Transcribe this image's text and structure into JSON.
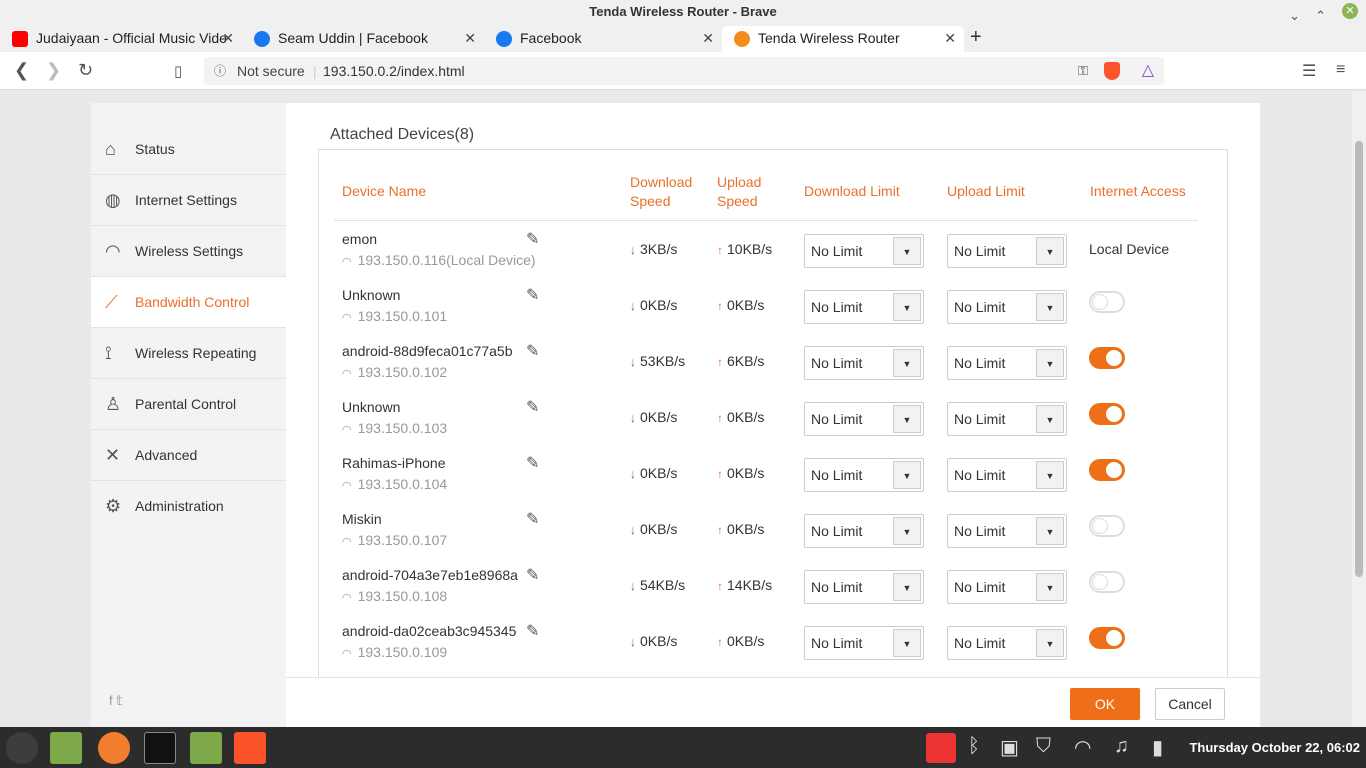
{
  "window": {
    "title": "Tenda Wireless Router - Brave",
    "min": "⌄",
    "max": "⌃",
    "close": "✕"
  },
  "tabs": [
    {
      "label": "Judaiyaan - Official Music Vide",
      "icon_color": "#ff0000"
    },
    {
      "label": "Seam Uddin | Facebook",
      "icon_color": "#1877f2"
    },
    {
      "label": "Facebook",
      "icon_color": "#1877f2"
    },
    {
      "label": "Tenda Wireless Router",
      "icon_color": "#f58b1f"
    }
  ],
  "tab_close": "✕",
  "new_tab": "+",
  "nav": {
    "security": "Not secure",
    "url": "193.150.0.2/index.html"
  },
  "sidebar": {
    "items": [
      {
        "label": "Status",
        "icon": "router-icon"
      },
      {
        "label": "Internet Settings",
        "icon": "globe-icon"
      },
      {
        "label": "Wireless Settings",
        "icon": "wifi-icon"
      },
      {
        "label": "Bandwidth Control",
        "icon": "chart-icon"
      },
      {
        "label": "Wireless Repeating",
        "icon": "antenna-icon"
      },
      {
        "label": "Parental Control",
        "icon": "family-icon"
      },
      {
        "label": "Advanced",
        "icon": "tools-icon"
      },
      {
        "label": "Administration",
        "icon": "gear-icon"
      }
    ],
    "active_index": 3,
    "social": "f  𝕥"
  },
  "panel": {
    "title": "Attached Devices(8)",
    "headers": {
      "device_name": "Device Name",
      "download_speed": "Download Speed",
      "upload_speed": "Upload Speed",
      "download_limit": "Download Limit",
      "upload_limit": "Upload Limit",
      "internet_access": "Internet Access"
    },
    "devices": [
      {
        "name": "emon",
        "ip": "193.150.0.116(Local Device)",
        "down": "3KB/s",
        "up": "10KB/s",
        "dl_limit": "No Limit",
        "ul_limit": "No Limit",
        "access": "Local Device"
      },
      {
        "name": "Unknown",
        "ip": "193.150.0.101",
        "down": "0KB/s",
        "up": "0KB/s",
        "dl_limit": "No Limit",
        "ul_limit": "No Limit",
        "access": false
      },
      {
        "name": "android-88d9feca01c77a5b",
        "ip": "193.150.0.102",
        "down": "53KB/s",
        "up": "6KB/s",
        "dl_limit": "No Limit",
        "ul_limit": "No Limit",
        "access": true
      },
      {
        "name": "Unknown",
        "ip": "193.150.0.103",
        "down": "0KB/s",
        "up": "0KB/s",
        "dl_limit": "No Limit",
        "ul_limit": "No Limit",
        "access": true
      },
      {
        "name": "Rahimas-iPhone",
        "ip": "193.150.0.104",
        "down": "0KB/s",
        "up": "0KB/s",
        "dl_limit": "No Limit",
        "ul_limit": "No Limit",
        "access": true
      },
      {
        "name": "Miskin",
        "ip": "193.150.0.107",
        "down": "0KB/s",
        "up": "0KB/s",
        "dl_limit": "No Limit",
        "ul_limit": "No Limit",
        "access": false
      },
      {
        "name": "android-704a3e7eb1e8968a",
        "ip": "193.150.0.108",
        "down": "54KB/s",
        "up": "14KB/s",
        "dl_limit": "No Limit",
        "ul_limit": "No Limit",
        "access": false
      },
      {
        "name": "android-da02ceab3c945345",
        "ip": "193.150.0.109",
        "down": "0KB/s",
        "up": "0KB/s",
        "dl_limit": "No Limit",
        "ul_limit": "No Limit",
        "access": true
      }
    ]
  },
  "buttons": {
    "ok": "OK",
    "cancel": "Cancel"
  },
  "taskbar": {
    "clock": "Thursday October 22, 06:02"
  },
  "colors": {
    "accent": "#ee6f17",
    "sidebar_bg": "#f3f3f3"
  }
}
